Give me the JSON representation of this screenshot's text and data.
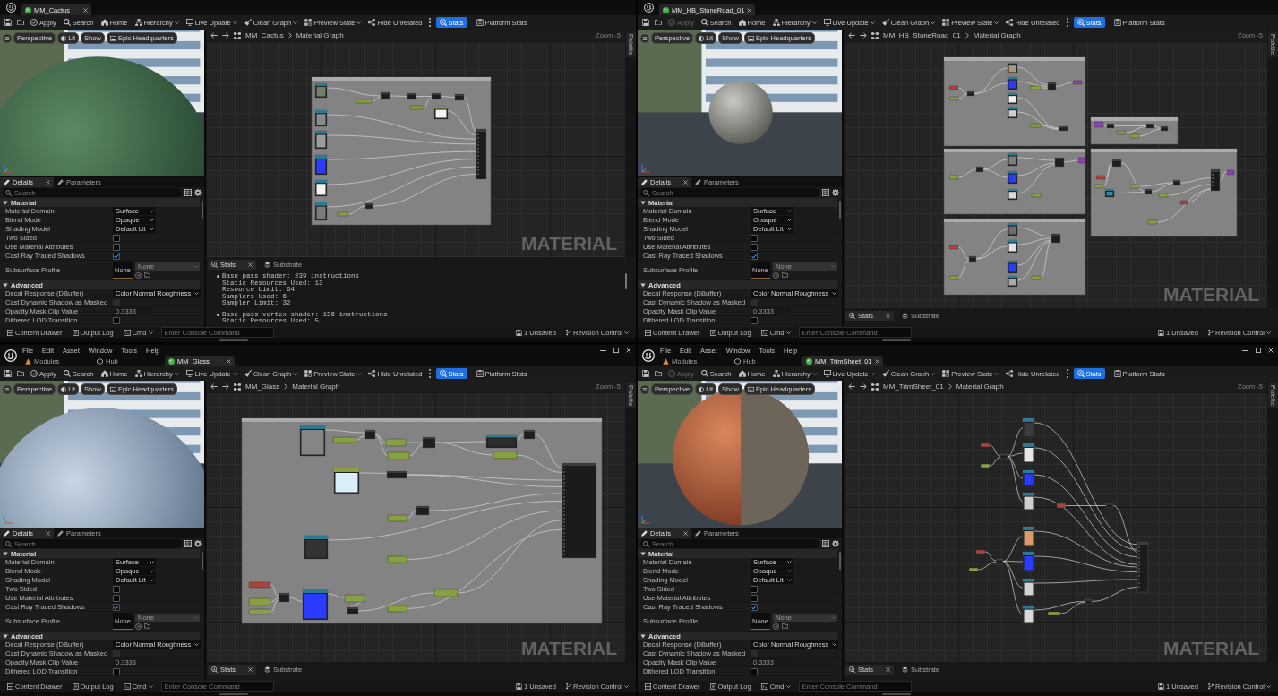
{
  "windows": [
    {
      "tabs": [
        {
          "label": "MM_Cactus",
          "selected": true
        }
      ],
      "toolbar": [
        {
          "label": "Apply",
          "kind": "button",
          "disabled": false
        },
        {
          "label": "Search",
          "kind": "button",
          "disabled": false
        },
        {
          "label": "Home",
          "kind": "button",
          "disabled": false
        },
        {
          "label": "Hierarchy",
          "kind": "dropdown",
          "disabled": false
        },
        {
          "label": "Live Update",
          "kind": "dropdown",
          "disabled": false
        },
        {
          "label": "Clean Graph",
          "kind": "dropdown",
          "disabled": false
        },
        {
          "label": "Preview State",
          "kind": "dropdown",
          "disabled": false
        },
        {
          "label": "Hide Unrelated",
          "kind": "button",
          "disabled": false
        }
      ],
      "toggles": [
        {
          "label": "Stats",
          "selected": true
        },
        {
          "label": "Platform Stats",
          "selected": false
        }
      ],
      "viewport": {
        "buttons": [
          "Perspective",
          "Lit",
          "Show",
          "Epic Headquarters"
        ]
      },
      "details": {
        "tabs": [
          {
            "label": "Details",
            "selected": true
          },
          {
            "label": "Parameters",
            "selected": false
          }
        ],
        "search": {
          "placeholder": "Search"
        },
        "sections": [
          {
            "title": "Material",
            "expanded": true,
            "rows": [
              {
                "label": "Material Domain",
                "kind": "dropdown",
                "value": "Surface",
                "disabled": false
              },
              {
                "label": "Blend Mode",
                "kind": "dropdown",
                "value": "Opaque",
                "disabled": false
              },
              {
                "label": "Shading Model",
                "kind": "dropdown",
                "value": "Default Lit",
                "disabled": false
              },
              {
                "label": "Two Sided",
                "kind": "checkbox",
                "checked": false,
                "disabled": false
              },
              {
                "label": "Use Material Attributes",
                "kind": "checkbox",
                "checked": false,
                "disabled": false
              },
              {
                "label": "Cast Ray Traced Shadows",
                "kind": "checkbox",
                "checked": true,
                "disabled": false
              },
              {
                "label": "Subsurface Profile",
                "kind": "profile",
                "thumbnail": "None",
                "value": "None",
                "disabled": true
              }
            ]
          },
          {
            "title": "Advanced",
            "expanded": true,
            "rows": [
              {
                "label": "Decal Response (DBuffer)",
                "kind": "dropdown",
                "value": "Color Normal Roughness",
                "disabled": false
              },
              {
                "label": "Cast Dynamic Shadow as Masked",
                "kind": "checkbox",
                "checked": false,
                "disabled": true
              },
              {
                "label": "Opacity Mask Clip Value",
                "kind": "number",
                "value": "0.3333",
                "disabled": true
              },
              {
                "label": "Dithered LOD Transition",
                "kind": "checkbox",
                "checked": false,
                "disabled": false
              }
            ]
          }
        ]
      },
      "breadcrumb": {
        "asset": "MM_Cactus",
        "graph": "Material Graph",
        "zoom": "Zoom -5"
      },
      "palette": "Palette",
      "graph_label": "MATERIAL",
      "stats": {
        "tabs": [
          {
            "label": "Stats",
            "selected": true
          },
          {
            "label": "Substrate",
            "selected": false
          }
        ],
        "entries": [
          {
            "title": "Base pass shader: 239 instructions",
            "details": [
              "Static Resources Used: 13",
              "Resource Limit: 64",
              "Samplers Used: 6",
              "Sampler Limit: 32"
            ]
          },
          {
            "title": "Base pass vertex shader: 156 instructions",
            "details": [
              "Static Resources Used: 5"
            ]
          }
        ]
      },
      "status_bar": {
        "content_drawer": "Content Drawer",
        "output_log": "Output Log",
        "cmd": "Cmd",
        "console": {
          "placeholder": "Enter Console Command"
        },
        "unsaved": "1 Unsaved",
        "revision_control": "Revision Control"
      }
    },
    {
      "tabs": [
        {
          "label": "MM_HB_StoneRoad_01",
          "selected": true
        }
      ],
      "toolbar": [
        {
          "label": "Apply",
          "kind": "button",
          "disabled": true
        },
        {
          "label": "Search",
          "kind": "button",
          "disabled": false
        },
        {
          "label": "Home",
          "kind": "button",
          "disabled": false
        },
        {
          "label": "Hierarchy",
          "kind": "dropdown",
          "disabled": false
        },
        {
          "label": "Live Update",
          "kind": "dropdown",
          "disabled": false
        },
        {
          "label": "Clean Graph",
          "kind": "dropdown",
          "disabled": false
        },
        {
          "label": "Preview State",
          "kind": "dropdown",
          "disabled": false
        },
        {
          "label": "Hide Unrelated",
          "kind": "button",
          "disabled": false
        }
      ],
      "toggles": [
        {
          "label": "Stats",
          "selected": true
        },
        {
          "label": "Platform Stats",
          "selected": false
        }
      ],
      "viewport": {
        "buttons": [
          "Perspective",
          "Lit",
          "Show",
          "Epic Headquarters"
        ]
      },
      "details": {
        "tabs": [
          {
            "label": "Details",
            "selected": true
          },
          {
            "label": "Parameters",
            "selected": false
          }
        ],
        "search": {
          "placeholder": "Search"
        },
        "sections": [
          {
            "title": "Material",
            "expanded": true,
            "rows": [
              {
                "label": "Material Domain",
                "kind": "dropdown",
                "value": "Surface",
                "disabled": false
              },
              {
                "label": "Blend Mode",
                "kind": "dropdown",
                "value": "Opaque",
                "disabled": false
              },
              {
                "label": "Shading Model",
                "kind": "dropdown",
                "value": "Default Lit",
                "disabled": false
              },
              {
                "label": "Two Sided",
                "kind": "checkbox",
                "checked": false,
                "disabled": false
              },
              {
                "label": "Use Material Attributes",
                "kind": "checkbox",
                "checked": false,
                "disabled": false
              },
              {
                "label": "Cast Ray Traced Shadows",
                "kind": "checkbox",
                "checked": true,
                "disabled": false
              },
              {
                "label": "Subsurface Profile",
                "kind": "profile",
                "thumbnail": "None",
                "value": "None",
                "disabled": true
              }
            ]
          },
          {
            "title": "Advanced",
            "expanded": true,
            "rows": [
              {
                "label": "Decal Response (DBuffer)",
                "kind": "dropdown",
                "value": "Color Normal Roughness",
                "disabled": false
              },
              {
                "label": "Cast Dynamic Shadow as Masked",
                "kind": "checkbox",
                "checked": false,
                "disabled": true
              },
              {
                "label": "Opacity Mask Clip Value",
                "kind": "number",
                "value": "0.3333",
                "disabled": true
              },
              {
                "label": "Dithered LOD Transition",
                "kind": "checkbox",
                "checked": false,
                "disabled": false
              }
            ]
          }
        ]
      },
      "breadcrumb": {
        "asset": "MM_HB_StoneRoad_01",
        "graph": "Material Graph",
        "zoom": "Zoom -5"
      },
      "palette": "Palette",
      "graph_label": "MATERIAL",
      "stats": {
        "tabs": [
          {
            "label": "Stats",
            "selected": true
          },
          {
            "label": "Substrate",
            "selected": false
          }
        ]
      },
      "status_bar": {
        "content_drawer": "Content Drawer",
        "output_log": "Output Log",
        "cmd": "Cmd",
        "console": {
          "placeholder": "Enter Console Command"
        },
        "unsaved": "1 Unsaved",
        "revision_control": "Revision Control"
      }
    },
    {
      "menu": [
        "File",
        "Edit",
        "Asset",
        "Window",
        "Tools",
        "Help"
      ],
      "tabs": [
        {
          "label": "Modules",
          "selected": false
        },
        {
          "label": "Hub",
          "selected": false
        },
        {
          "label": "MM_Glass",
          "selected": true
        }
      ],
      "toolbar": [
        {
          "label": "Apply",
          "kind": "button",
          "disabled": false
        },
        {
          "label": "Search",
          "kind": "button",
          "disabled": false
        },
        {
          "label": "Home",
          "kind": "button",
          "disabled": false
        },
        {
          "label": "Hierarchy",
          "kind": "dropdown",
          "disabled": false
        },
        {
          "label": "Live Update",
          "kind": "dropdown",
          "disabled": false
        },
        {
          "label": "Clean Graph",
          "kind": "dropdown",
          "disabled": false
        },
        {
          "label": "Preview State",
          "kind": "dropdown",
          "disabled": false
        },
        {
          "label": "Hide Unrelated",
          "kind": "button",
          "disabled": false
        }
      ],
      "toggles": [
        {
          "label": "Stats",
          "selected": true
        },
        {
          "label": "Platform Stats",
          "selected": false
        }
      ],
      "viewport": {
        "buttons": [
          "Perspective",
          "Lit",
          "Show",
          "Epic Headquarters"
        ]
      },
      "details": {
        "tabs": [
          {
            "label": "Details",
            "selected": true
          },
          {
            "label": "Parameters",
            "selected": false
          }
        ],
        "search": {
          "placeholder": "Search"
        },
        "sections": [
          {
            "title": "Material",
            "expanded": true,
            "rows": [
              {
                "label": "Material Domain",
                "kind": "dropdown",
                "value": "Surface",
                "disabled": false
              },
              {
                "label": "Blend Mode",
                "kind": "dropdown",
                "value": "Opaque",
                "disabled": false
              },
              {
                "label": "Shading Model",
                "kind": "dropdown",
                "value": "Default Lit",
                "disabled": false
              },
              {
                "label": "Two Sided",
                "kind": "checkbox",
                "checked": false,
                "disabled": false
              },
              {
                "label": "Use Material Attributes",
                "kind": "checkbox",
                "checked": false,
                "disabled": false
              },
              {
                "label": "Cast Ray Traced Shadows",
                "kind": "checkbox",
                "checked": true,
                "disabled": false
              },
              {
                "label": "Subsurface Profile",
                "kind": "profile",
                "thumbnail": "None",
                "value": "None",
                "disabled": true
              }
            ]
          },
          {
            "title": "Advanced",
            "expanded": true,
            "rows": [
              {
                "label": "Decal Response (DBuffer)",
                "kind": "dropdown",
                "value": "Color Normal Roughness",
                "disabled": false
              },
              {
                "label": "Cast Dynamic Shadow as Masked",
                "kind": "checkbox",
                "checked": false,
                "disabled": true
              },
              {
                "label": "Opacity Mask Clip Value",
                "kind": "number",
                "value": "0.3333",
                "disabled": true
              },
              {
                "label": "Dithered LOD Transition",
                "kind": "checkbox",
                "checked": false,
                "disabled": false
              }
            ]
          }
        ]
      },
      "breadcrumb": {
        "asset": "MM_Glass",
        "graph": "Material Graph",
        "zoom": "Zoom -5"
      },
      "palette": "Palette",
      "graph_label": "MATERIAL",
      "stats": {
        "tabs": [
          {
            "label": "Stats",
            "selected": true
          },
          {
            "label": "Substrate",
            "selected": false
          }
        ]
      },
      "status_bar": {
        "content_drawer": "Content Drawer",
        "output_log": "Output Log",
        "cmd": "Cmd",
        "console": {
          "placeholder": "Enter Console Command"
        },
        "unsaved": "1 Unsaved",
        "revision_control": "Revision Control"
      }
    },
    {
      "menu": [
        "File",
        "Edit",
        "Asset",
        "Window",
        "Tools",
        "Help"
      ],
      "tabs": [
        {
          "label": "Modules",
          "selected": false
        },
        {
          "label": "Hub",
          "selected": false
        },
        {
          "label": "MM_TrimSheet_01",
          "selected": true
        }
      ],
      "toolbar": [
        {
          "label": "Apply",
          "kind": "button",
          "disabled": true
        },
        {
          "label": "Search",
          "kind": "button",
          "disabled": false
        },
        {
          "label": "Home",
          "kind": "button",
          "disabled": false
        },
        {
          "label": "Hierarchy",
          "kind": "dropdown",
          "disabled": false
        },
        {
          "label": "Live Update",
          "kind": "dropdown",
          "disabled": false
        },
        {
          "label": "Clean Graph",
          "kind": "dropdown",
          "disabled": false
        },
        {
          "label": "Preview State",
          "kind": "dropdown",
          "disabled": false
        },
        {
          "label": "Hide Unrelated",
          "kind": "button",
          "disabled": false
        }
      ],
      "toggles": [
        {
          "label": "Stats",
          "selected": true
        },
        {
          "label": "Platform Stats",
          "selected": false
        }
      ],
      "viewport": {
        "buttons": [
          "Perspective",
          "Lit",
          "Show",
          "Epic Headquarters"
        ]
      },
      "details": {
        "tabs": [
          {
            "label": "Details",
            "selected": true
          },
          {
            "label": "Parameters",
            "selected": false
          }
        ],
        "search": {
          "placeholder": "Search"
        },
        "sections": [
          {
            "title": "Material",
            "expanded": true,
            "rows": [
              {
                "label": "Material Domain",
                "kind": "dropdown",
                "value": "Surface",
                "disabled": false
              },
              {
                "label": "Blend Mode",
                "kind": "dropdown",
                "value": "Opaque",
                "disabled": false
              },
              {
                "label": "Shading Model",
                "kind": "dropdown",
                "value": "Default Lit",
                "disabled": false
              },
              {
                "label": "Two Sided",
                "kind": "checkbox",
                "checked": false,
                "disabled": false
              },
              {
                "label": "Use Material Attributes",
                "kind": "checkbox",
                "checked": false,
                "disabled": false
              },
              {
                "label": "Cast Ray Traced Shadows",
                "kind": "checkbox",
                "checked": true,
                "disabled": false
              },
              {
                "label": "Subsurface Profile",
                "kind": "profile",
                "thumbnail": "None",
                "value": "None",
                "disabled": true
              }
            ]
          },
          {
            "title": "Advanced",
            "expanded": true,
            "rows": [
              {
                "label": "Decal Response (DBuffer)",
                "kind": "dropdown",
                "value": "Color Normal Roughness",
                "disabled": false
              },
              {
                "label": "Cast Dynamic Shadow as Masked",
                "kind": "checkbox",
                "checked": false,
                "disabled": true
              },
              {
                "label": "Opacity Mask Clip Value",
                "kind": "number",
                "value": "0.3333",
                "disabled": true
              },
              {
                "label": "Dithered LOD Transition",
                "kind": "checkbox",
                "checked": false,
                "disabled": false
              }
            ]
          }
        ]
      },
      "breadcrumb": {
        "asset": "MM_TrimSheet_01",
        "graph": "Material Graph",
        "zoom": "Zoom -5"
      },
      "palette": "Palette",
      "graph_label": "MATERIAL",
      "stats": {
        "tabs": [
          {
            "label": "Stats",
            "selected": true
          },
          {
            "label": "Substrate",
            "selected": false
          }
        ]
      },
      "status_bar": {
        "content_drawer": "Content Drawer",
        "output_log": "Output Log",
        "cmd": "Cmd",
        "console": {
          "placeholder": "Enter Console Command"
        },
        "unsaved": "1 Unsaved",
        "revision_control": "Revision Control"
      }
    }
  ]
}
